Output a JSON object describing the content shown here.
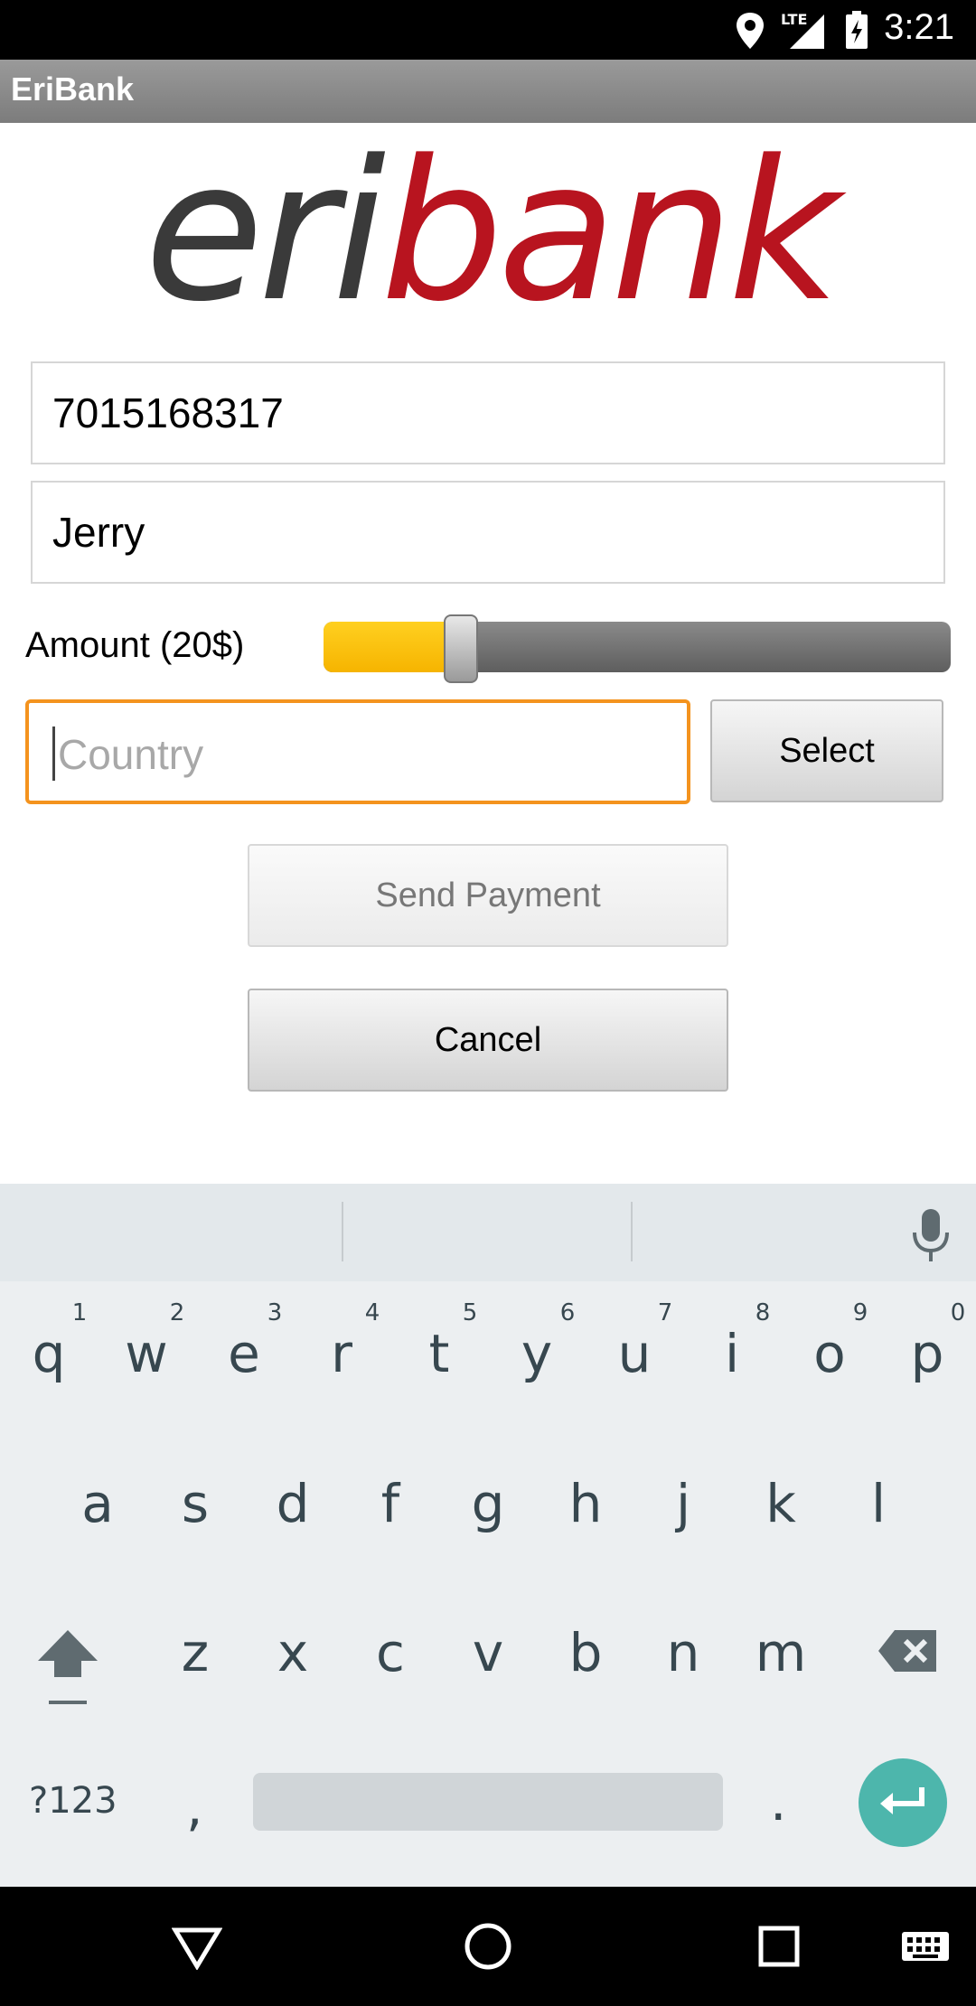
{
  "status_bar": {
    "time": "3:21",
    "network": "LTE",
    "icons": [
      "location-icon",
      "signal-icon",
      "battery-charging-icon"
    ]
  },
  "app_bar": {
    "title": "EriBank"
  },
  "logo": {
    "part1": "eri",
    "part2": "bank"
  },
  "form": {
    "phone_value": "7015168317",
    "name_value": "Jerry",
    "amount_label": "Amount (20$)",
    "amount_fraction": 0.2,
    "country_placeholder": "Country",
    "select_label": "Select",
    "send_label": "Send Payment",
    "cancel_label": "Cancel"
  },
  "keyboard": {
    "row1": [
      "q",
      "w",
      "e",
      "r",
      "t",
      "y",
      "u",
      "i",
      "o",
      "p"
    ],
    "row1_hints": [
      "1",
      "2",
      "3",
      "4",
      "5",
      "6",
      "7",
      "8",
      "9",
      "0"
    ],
    "row2": [
      "a",
      "s",
      "d",
      "f",
      "g",
      "h",
      "j",
      "k",
      "l"
    ],
    "row3": [
      "z",
      "x",
      "c",
      "v",
      "b",
      "n",
      "m"
    ],
    "symbols_label": "?123",
    "comma": ",",
    "period": "."
  },
  "colors": {
    "accent": "#f4931e",
    "brand_red": "#b8141f",
    "slider_fill": "#f6b400",
    "enter_key": "#4db6ac"
  }
}
